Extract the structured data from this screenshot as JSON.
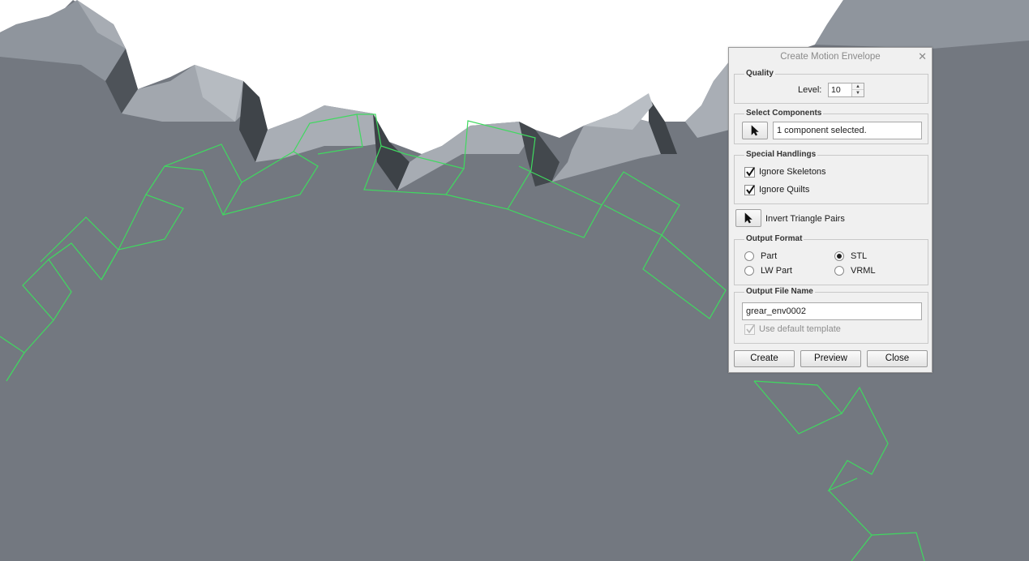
{
  "dialog": {
    "title": "Create Motion Envelope",
    "quality": {
      "group_label": "Quality",
      "level_label": "Level:",
      "level_value": "10"
    },
    "select_components": {
      "group_label": "Select Components",
      "status_text": "1 component selected."
    },
    "special_handlings": {
      "group_label": "Special Handlings",
      "ignore_skeletons": {
        "label": "Ignore Skeletons",
        "checked": true
      },
      "ignore_quilts": {
        "label": "Ignore Quilts",
        "checked": true
      }
    },
    "invert_triangle_pairs_label": "Invert Triangle Pairs",
    "output_format": {
      "group_label": "Output Format",
      "options": [
        {
          "label": "Part",
          "selected": false
        },
        {
          "label": "STL",
          "selected": true
        },
        {
          "label": "LW Part",
          "selected": false
        },
        {
          "label": "VRML",
          "selected": false
        }
      ]
    },
    "output_file_name": {
      "group_label": "Output File Name",
      "value": "grear_env0002",
      "use_default_template": {
        "label": "Use default template",
        "checked": true,
        "disabled": true
      }
    },
    "buttons": {
      "create": "Create",
      "preview": "Preview",
      "close": "Close"
    }
  },
  "colors": {
    "viewport_background": "#737880",
    "gear_envelope_wireframe": "#3fd95f",
    "dialog_background": "#f0f0f0"
  },
  "icons": {
    "dialog_close": "close-icon",
    "select_components_button": "arrow-cursor-icon",
    "invert_triangle_button": "arrow-cursor-icon",
    "spinner_up": "chevron-up-icon",
    "spinner_down": "chevron-down-icon"
  }
}
